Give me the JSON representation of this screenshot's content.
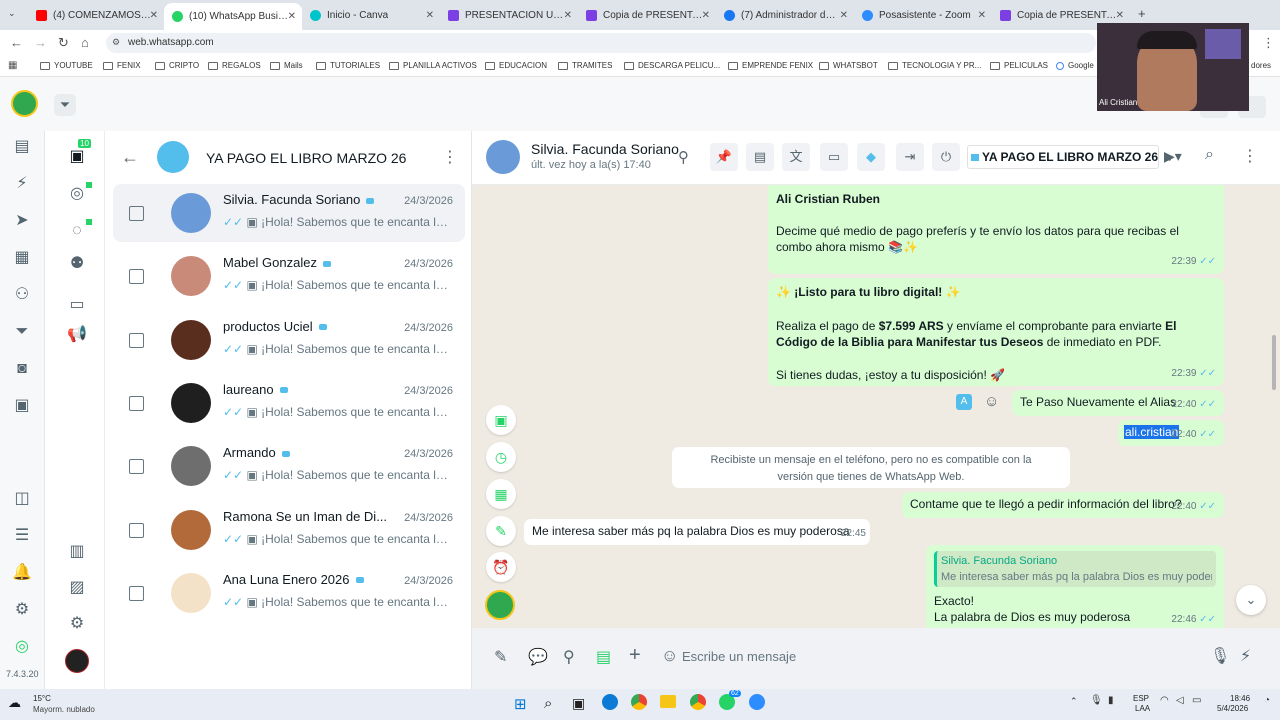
{
  "browser": {
    "tabs": [
      {
        "title": "(4) COMENZAMOS EN BF",
        "color": "#ff0000"
      },
      {
        "title": "(10) WhatsApp Business",
        "color": "#25d366"
      },
      {
        "title": "Inicio - Canva",
        "color": "#00c4cc"
      },
      {
        "title": "PRESENTACION UNICA",
        "color": "#7b3fe4"
      },
      {
        "title": "Copia de PRESENTACION",
        "color": "#7b3fe4"
      },
      {
        "title": "(7) Administrador de anu",
        "color": "#1877f2"
      },
      {
        "title": "Posasistente - Zoom",
        "color": "#2d8cff"
      },
      {
        "title": "Copia de PRESENTACION",
        "color": "#7b3fe4"
      }
    ],
    "url": "web.whatsapp.com",
    "bookmarks": [
      "YOUTUBE",
      "FENIX",
      "CRIPTO",
      "REGALOS",
      "Mails",
      "TUTORIALES",
      "PLANILLA ACTIVOS",
      "EDUCACION",
      "TRAMITES",
      "DESCARGA PELICU...",
      "EMPRENDE FENIX",
      "WHATSBOT",
      "TECNOLOGIA Y PR...",
      "PELICULAS",
      "Google",
      "dores"
    ]
  },
  "webcam": {
    "name": "Ali Cristian"
  },
  "rail": {
    "version": "7.4.3.20",
    "badge": "10"
  },
  "list": {
    "title": "YA PAGO EL LIBRO MARZO 26",
    "chats": [
      {
        "name": "Silvia. Facunda Soriano",
        "date": "24/3/2026",
        "preview": "¡Hola! Sabemos que te encanta la l...",
        "avatar": "#6a9bd8",
        "selected": true
      },
      {
        "name": "Mabel Gonzalez",
        "date": "24/3/2026",
        "preview": "¡Hola! Sabemos que te encanta la l...",
        "avatar": "#c98a7a"
      },
      {
        "name": "productos Uciel",
        "date": "24/3/2026",
        "preview": "¡Hola! Sabemos que te encanta la l...",
        "avatar": "#5a2e1e"
      },
      {
        "name": "laureano",
        "date": "24/3/2026",
        "preview": "¡Hola! Sabemos que te encanta la l...",
        "avatar": "#1f1f1f"
      },
      {
        "name": "Armando",
        "date": "24/3/2026",
        "preview": "¡Hola! Sabemos que te encanta la l...",
        "avatar": "#6e6e6e"
      },
      {
        "name": "Ramona Se un Iman de Di...",
        "date": "24/3/2026",
        "preview": "¡Hola! Sabemos que te encanta la l...",
        "avatar": "#b36a3a"
      },
      {
        "name": "Ana Luna Enero 2026",
        "date": "24/3/2026",
        "preview": "¡Hola! Sabemos que te encanta la l...",
        "avatar": "#f3e2c7"
      }
    ]
  },
  "chat": {
    "contact": "Silvia. Facunda Soriano",
    "status": "últ. vez hoy a la(s) 17:40",
    "label": "YA PAGO EL LIBRO MARZO 26",
    "msgs": {
      "m1_author": "Ali Cristian Ruben",
      "m1_text": "Decime qué medio de pago preferís y te envío los datos para que recibas el combo ahora mismo 📚✨",
      "m1_time": "22:39",
      "m2_title": "✨ ¡Listo para tu libro digital! ✨",
      "m2_p1a": "Realiza el pago de ",
      "m2_amount": "$7.599 ARS",
      "m2_p1b": " y envíame el comprobante para enviarte ",
      "m2_book": "El Código de la Biblia para Manifestar tus Deseos",
      "m2_p1c": " de inmediato en PDF.",
      "m2_p2": "Si tienes dudas, ¡estoy a tu disposición! 🚀",
      "m2_time": "22:39",
      "m3_text": "Te Paso Nuevamente el Alias",
      "m3_time": "22:40",
      "m4_text": "ali.cristian",
      "m4_time": "22:40",
      "sys": "Recibiste un mensaje en el teléfono, pero no es compatible con la versión que tienes de WhatsApp Web.",
      "m5_text": "Contame que te llegó a pedir información del libro?",
      "m5_time": "22:40",
      "m6_text": "Me interesa saber más pq la palabra Dios es muy poderosa",
      "m6_time": "22:45",
      "m7_quote_author": "Silvia. Facunda Soriano",
      "m7_quote_text": "Me interesa saber más pq la palabra Dios es muy poderosa",
      "m7_l1": "Exacto!",
      "m7_l2": "La palabra de Dios es muy poderosa",
      "m7_time": "22:46"
    },
    "placeholder": "Escribe un mensaje"
  },
  "taskbar": {
    "weather_temp": "15°C",
    "weather_desc": "Mayorm. nublado",
    "lang1": "ESP",
    "lang2": "LAA",
    "time": "18:46",
    "date": "5/4/2026",
    "badge": "62"
  }
}
